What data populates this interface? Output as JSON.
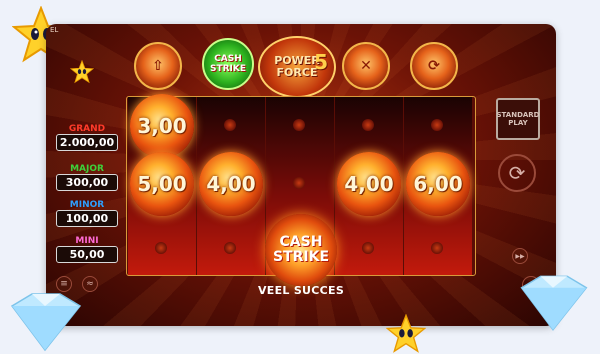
{
  "game": {
    "logo_line1": "POWER",
    "logo_line2": "FORCE",
    "logo_number": "5",
    "cash_strike_line1": "CASH",
    "cash_strike_line2": "STRIKE",
    "status_message": "VEEL SUCCES",
    "corner_label": "EL"
  },
  "jackpots": [
    {
      "name": "GRAND",
      "value": "2.000,00",
      "color": "#ff3b2a"
    },
    {
      "name": "MAJOR",
      "value": "300,00",
      "color": "#3ed13a"
    },
    {
      "name": "MINOR",
      "value": "100,00",
      "color": "#2ea0ff"
    },
    {
      "name": "MINI",
      "value": "50,00",
      "color": "#ff6ad5"
    }
  ],
  "orbs": [
    {
      "reel": 1,
      "row": 1,
      "value": "3,00"
    },
    {
      "reel": 1,
      "row": 2,
      "value": "5,00"
    },
    {
      "reel": 2,
      "row": 2,
      "value": "4,00"
    },
    {
      "reel": 4,
      "row": 2,
      "value": "4,00"
    },
    {
      "reel": 5,
      "row": 2,
      "value": "6,00"
    }
  ],
  "bonus_symbol": {
    "line1": "CASH",
    "line2": "STRIKE"
  },
  "top_buttons": [
    {
      "name": "up-arrow-icon",
      "glyph": "⇧"
    },
    {
      "name": "close-icon",
      "glyph": "✕"
    },
    {
      "name": "refresh-icon",
      "glyph": "⟳"
    }
  ],
  "feature_button": {
    "line1": "STANDARD",
    "line2": "PLAY"
  },
  "controls": {
    "spin_glyph": "⟳",
    "autoplay_glyph": "▶▶",
    "sound_glyph": "🔈",
    "menu_glyph": "≡",
    "stats_glyph": "≈"
  },
  "colors": {
    "frame_red": "#6b1206",
    "gold": "#f3b64a"
  }
}
